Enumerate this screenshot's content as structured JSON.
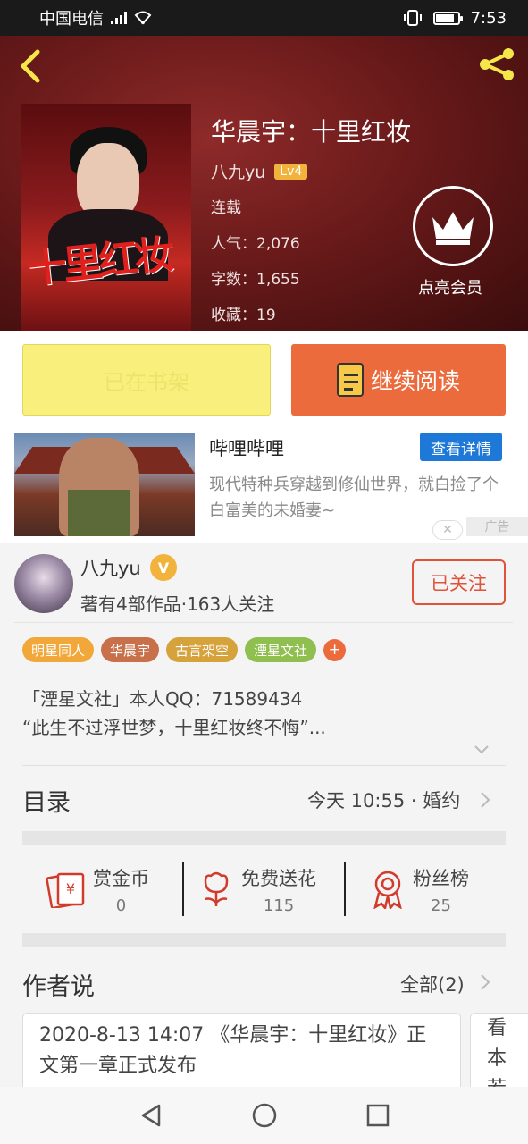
{
  "status_bar": {
    "carrier": "中国电信",
    "network": "2G",
    "time": "7:53"
  },
  "header": {
    "book_title": "华晨宇：十里红妆",
    "author": "八九yu",
    "level": "Lv4",
    "status": "连载",
    "popularity": "人气：2,076",
    "word_count": "字数：1,655",
    "favorites": "收藏：19",
    "cover_text": "十里红妆",
    "vip_label": "点亮会员",
    "icons": [
      "back-icon",
      "share-icon",
      "crown-icon"
    ]
  },
  "actions": {
    "shelf_label": "已在书架",
    "read_label": "继续阅读"
  },
  "ad": {
    "title": "哔哩哔哩",
    "button": "查看详情",
    "description": "现代特种兵穿越到修仙世界，就白捡了个白富美的未婚妻~",
    "tag": "广告"
  },
  "author_card": {
    "name": "八九yu",
    "badge": "V",
    "subtitle": "著有4部作品·163人关注",
    "follow_label": "已关注"
  },
  "tags": [
    {
      "label": "明星同人",
      "color": "#f2a73a"
    },
    {
      "label": "华晨宇",
      "color": "#c8704a"
    },
    {
      "label": "古言架空",
      "color": "#d6a23c"
    },
    {
      "label": "湮星文社",
      "color": "#8fbf4f"
    }
  ],
  "tag_add": "+",
  "description": {
    "line1": "「湮星文社」本人QQ：71589434",
    "line2": "“此生不过浮世梦，十里红妆终不悔”..."
  },
  "toc": {
    "title": "目录",
    "latest": "今天 10:55 · 婚约"
  },
  "stats": [
    {
      "label": "赏金币",
      "value": "0",
      "icon": "red-envelope-icon"
    },
    {
      "label": "免费送花",
      "value": "115",
      "icon": "flower-icon"
    },
    {
      "label": "粉丝榜",
      "value": "25",
      "icon": "award-ribbon-icon"
    }
  ],
  "author_says": {
    "title": "作者说",
    "all_label": "全部(2)",
    "post1": "2020-8-13 14:07 《华晨宇：十里红妆》正文第一章正式发布",
    "post2": "看\n本\n若"
  },
  "colors": {
    "accent_orange": "#ec6b3d",
    "shelf_yellow": "#f9ef7d",
    "follow_red": "#e0533a",
    "ad_blue": "#1e78d7",
    "header_bg": "#6a1a1a"
  }
}
